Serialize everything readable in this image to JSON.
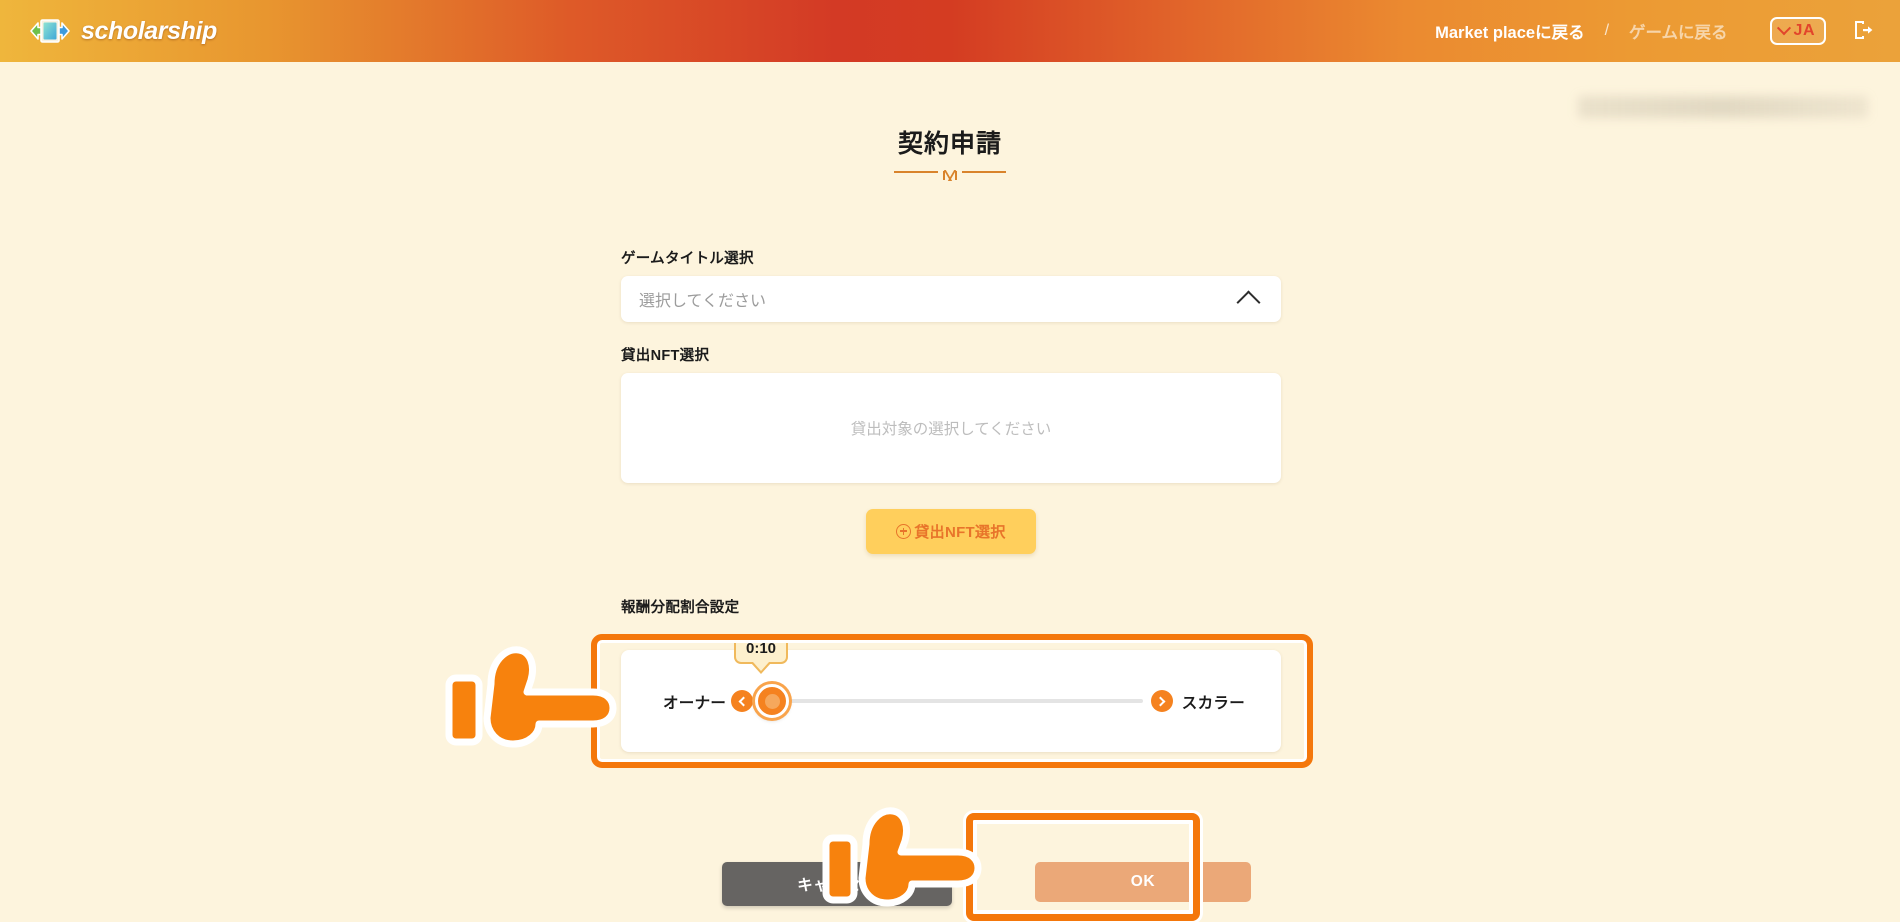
{
  "header": {
    "brand_name": "scholarship",
    "logo_icon": "book-exchange-icon",
    "links": [
      {
        "label": "Market placeに戻る",
        "muted": false
      },
      {
        "label": "ゲームに戻る",
        "muted": true
      }
    ],
    "separator": "/",
    "language": {
      "value": "JA",
      "chevron_icon": "chevron-down-icon"
    },
    "logout_icon": "logout-icon"
  },
  "page": {
    "title": "契約申請",
    "redacted_text": ""
  },
  "form": {
    "game_title": {
      "label": "ゲームタイトル選択",
      "placeholder": "選択してください",
      "value": "",
      "chevron_icon": "chevron-up-icon"
    },
    "lending_nft": {
      "label": "貸出NFT選択",
      "empty_text": "貸出対象の選択してください",
      "add_button": {
        "label": "貸出NFT選択",
        "icon": "plus-circle-icon"
      }
    },
    "reward_ratio": {
      "label": "報酬分配割合設定",
      "tooltip_value": "0:10",
      "owner_label": "オーナー",
      "scholar_label": "スカラー",
      "decrement_icon": "chevron-left-circle-icon",
      "increment_icon": "chevron-right-circle-icon",
      "slider": {
        "min": 0,
        "max": 10,
        "value": 0
      }
    }
  },
  "actions": {
    "cancel_label": "キャンセル",
    "ok_label": "OK"
  },
  "colors": {
    "accent_orange": "#F4770B",
    "brand_yellow": "#FFCF5C",
    "page_bg": "#FDF4DD",
    "cancel_gray": "#666462",
    "ok_disabled": "#EBA878",
    "slider_orange": "#F5821F"
  },
  "cursors": [
    {
      "name": "pointing-hand-slider",
      "icon": "hand-pointing-right-icon"
    },
    {
      "name": "pointing-hand-ok",
      "icon": "hand-pointing-right-icon"
    }
  ]
}
